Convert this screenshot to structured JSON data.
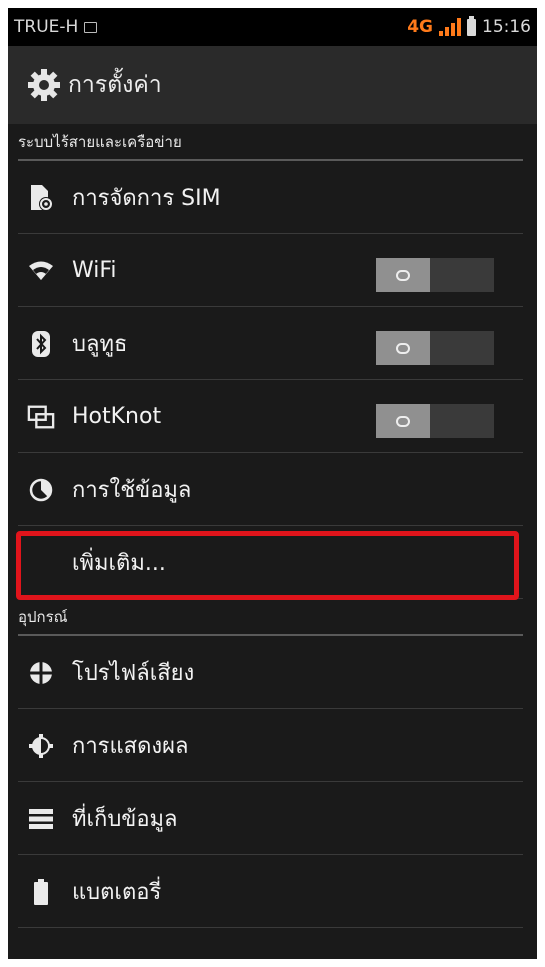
{
  "status_bar": {
    "carrier": "TRUE-H",
    "network": "4G",
    "time": "15:16"
  },
  "action_bar": {
    "title": "การตั้งค่า"
  },
  "sections": [
    {
      "header": "ระบบไร้สายและเครือข่าย",
      "items": [
        {
          "label": "การจัดการ SIM",
          "icon": "sim-manage-icon"
        },
        {
          "label": "WiFi",
          "icon": "wifi-icon",
          "toggle": "off"
        },
        {
          "label": "บลูทูธ",
          "icon": "bluetooth-icon",
          "toggle": "off"
        },
        {
          "label": "HotKnot",
          "icon": "hotknot-icon",
          "toggle": "off"
        },
        {
          "label": "การใช้ข้อมูล",
          "icon": "data-usage-icon"
        },
        {
          "label": "เพิ่มเติม...",
          "icon": null,
          "highlighted": true
        }
      ]
    },
    {
      "header": "อุปกรณ์",
      "items": [
        {
          "label": "โปรไฟล์เสียง",
          "icon": "audio-profile-icon"
        },
        {
          "label": "การแสดงผล",
          "icon": "display-icon"
        },
        {
          "label": "ที่เก็บข้อมูล",
          "icon": "storage-icon"
        },
        {
          "label": "แบตเตอรี่",
          "icon": "battery-icon"
        }
      ]
    }
  ],
  "colors": {
    "background": "#1a1a1a",
    "action_bar": "#2a2a2a",
    "highlight": "#e0141b",
    "network_accent": "#ff7a1a"
  }
}
